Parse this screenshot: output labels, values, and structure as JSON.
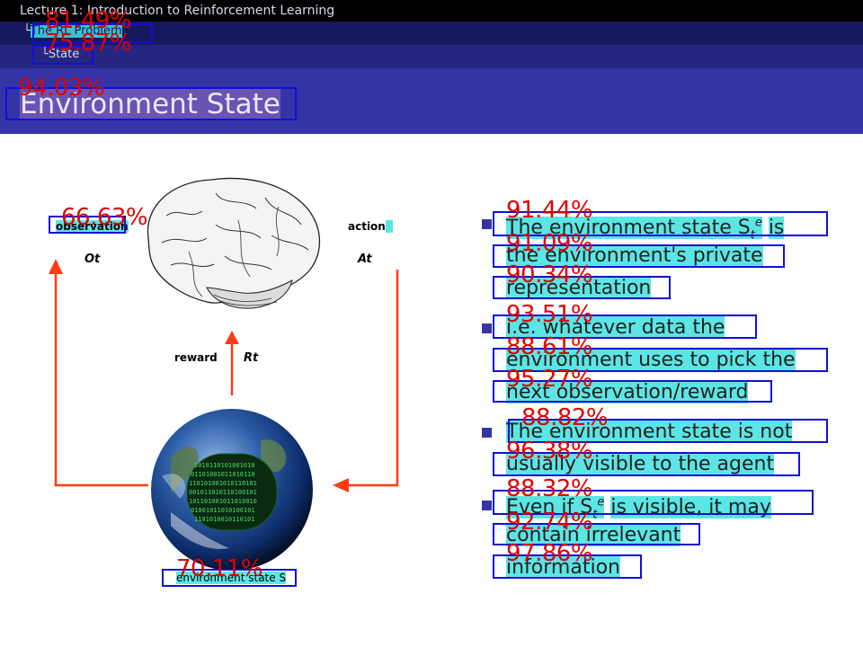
{
  "nav": {
    "lecture": "Lecture 1: Introduction to Reinforcement Learning",
    "section_prefix": "└",
    "section": "The RL Problem",
    "subsection_prefix": "└",
    "subsection": "State"
  },
  "slide": {
    "title": "Environment State"
  },
  "diagram": {
    "observation": "observation",
    "observation_sym": "Ot",
    "action": "action",
    "action_sym": "At",
    "reward": "reward",
    "reward_sym": "Rt",
    "env_state": "environment state S"
  },
  "bullets": [
    {
      "lines": [
        "The environment state S",
        "is",
        "the environment's private",
        "representation"
      ],
      "sym": "t",
      "sup": "e"
    },
    {
      "lines": [
        "i.e. whatever data the",
        "environment uses to pick the",
        "next observation/reward"
      ]
    },
    {
      "lines": [
        "The environment state is not",
        "usually visible to the agent"
      ]
    },
    {
      "lines": [
        "Even if S",
        "is visible, it may",
        "contain irrelevant",
        "information"
      ],
      "sym": "t",
      "sup": "e"
    }
  ],
  "scores": {
    "section": "81.49%",
    "subsection": "75.87%",
    "title": "94.03%",
    "observation": "66.63%",
    "env_state": "70.11%",
    "b1l1": "91.44%",
    "b1l2": "91.09%",
    "b1l3": "90.34%",
    "b2l1": "93.51%",
    "b2l2": "88.61%",
    "b2l3": "95.27%",
    "b3l1": "88.82%",
    "b3l2": "96.38%",
    "b4l1": "88.32%",
    "b4l2": "92.74%",
    "b4l3": "97.86%"
  },
  "colors": {
    "highlight": "#40e0e0",
    "box": "#1010d8",
    "score": "#e00000",
    "theme": "#3434a6",
    "arrow": "#ff3b16"
  }
}
